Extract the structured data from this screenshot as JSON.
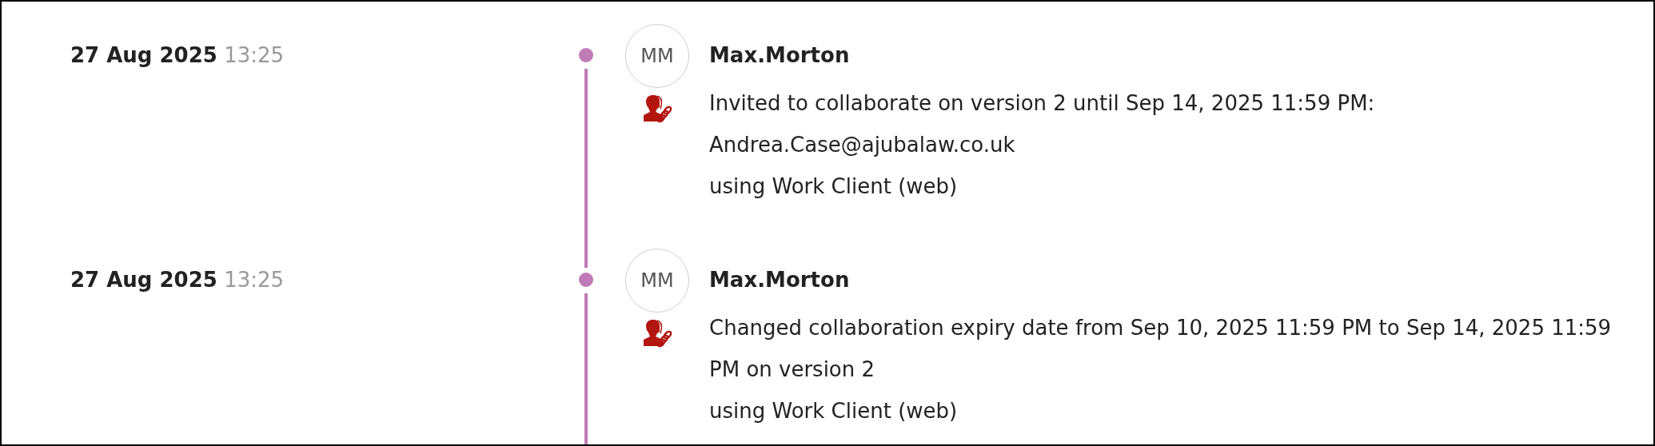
{
  "activity": [
    {
      "date": "27 Aug 2025",
      "time": "13:25",
      "initials": "MM",
      "user": "Max.Morton",
      "details": [
        "Invited to collaborate on version 2 until Sep 14, 2025 11:59 PM:",
        "Andrea.Case@ajubalaw.co.uk",
        "using Work Client (web)"
      ]
    },
    {
      "date": "27 Aug 2025",
      "time": "13:25",
      "initials": "MM",
      "user": "Max.Morton",
      "details": [
        "Changed collaboration expiry date from Sep 10, 2025 11:59 PM to Sep 14, 2025 11:59 PM on version 2",
        "using Work Client (web)"
      ]
    }
  ]
}
